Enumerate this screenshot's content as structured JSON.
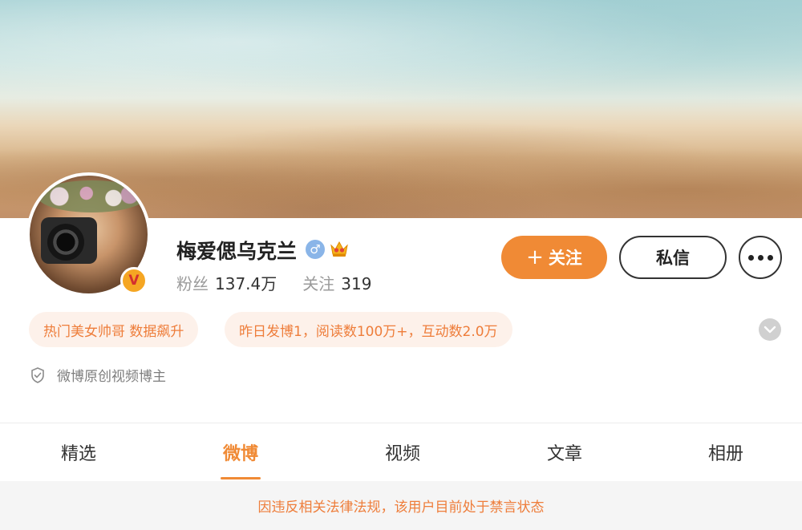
{
  "profile": {
    "username": "梅爱偲乌克兰",
    "verified_badge": "V",
    "gender": "♂",
    "gender_icon": "male-icon",
    "vip_icon": "crown-icon",
    "stats": {
      "followers_label": "粉丝",
      "followers_value": "137.4万",
      "following_label": "关注",
      "following_value": "319"
    }
  },
  "actions": {
    "follow_plus": "+",
    "follow_label": "关注",
    "message_label": "私信",
    "more_icon": "more-dots-icon"
  },
  "tags": [
    "热门美女帅哥 数据飙升",
    "昨日发博1，阅读数100万+，互动数2.0万"
  ],
  "certification": {
    "icon": "shield-check-icon",
    "text": "微博原创视频博主"
  },
  "tabs": [
    {
      "label": "精选"
    },
    {
      "label": "微博"
    },
    {
      "label": "视频"
    },
    {
      "label": "文章"
    },
    {
      "label": "相册"
    }
  ],
  "active_tab": "微博",
  "notice": "因违反相关法律法规，该用户目前处于禁言状态",
  "colors": {
    "accent": "#f08a35",
    "tag_text": "#ee7d3a",
    "tag_bg": "#fdf1ea"
  }
}
